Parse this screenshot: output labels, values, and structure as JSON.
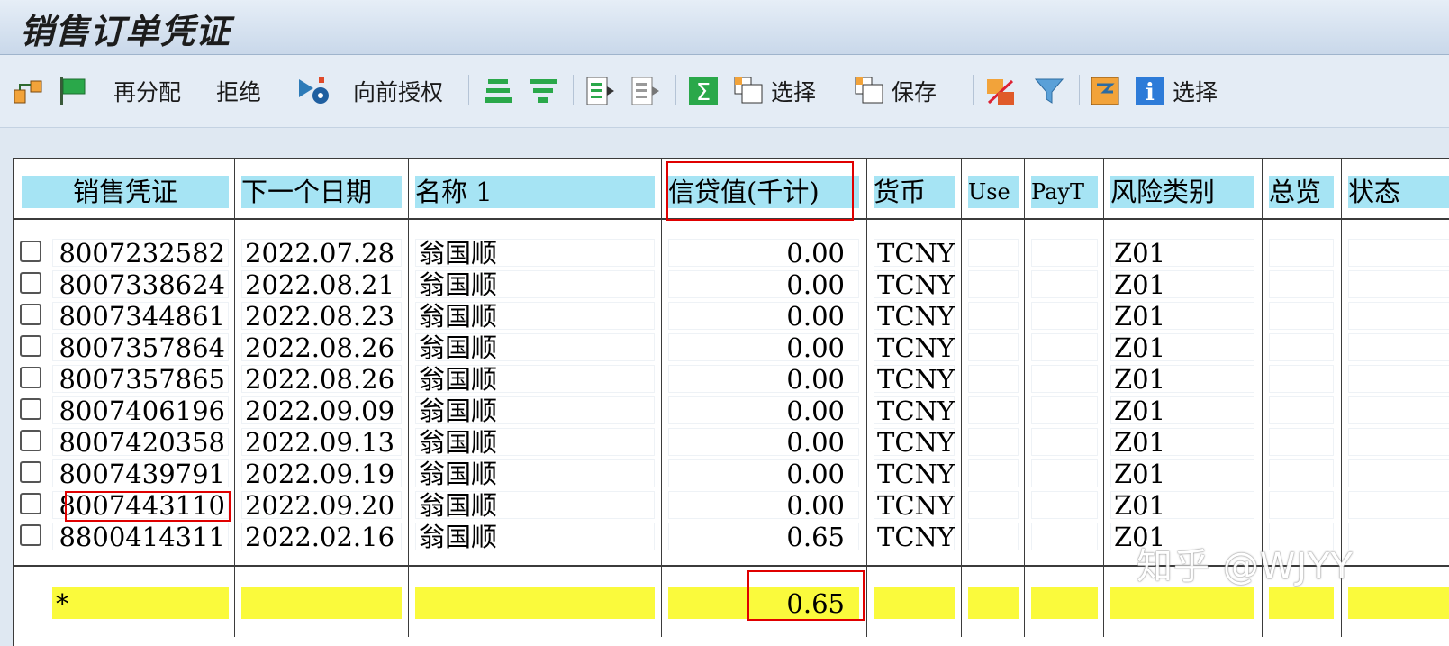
{
  "title": "销售订单凭证",
  "toolbar": {
    "reassign": "再分配",
    "reject": "拒绝",
    "forward_auth": "向前授权",
    "select1": "选择",
    "save": "保存",
    "select2": "选择"
  },
  "columns": [
    "销售凭证",
    "下一个日期",
    "名称 1",
    "信贷值(千计)",
    "货币",
    "Use",
    "PayT",
    "风险类别",
    "总览",
    "状态"
  ],
  "rows": [
    {
      "doc": "8007232582",
      "date": "2022.07.28",
      "name": "翁国顺",
      "credit": "0.00",
      "cur": "TCNY",
      "use": "",
      "payt": "",
      "risk": "Z01"
    },
    {
      "doc": "8007338624",
      "date": "2022.08.21",
      "name": "翁国顺",
      "credit": "0.00",
      "cur": "TCNY",
      "use": "",
      "payt": "",
      "risk": "Z01"
    },
    {
      "doc": "8007344861",
      "date": "2022.08.23",
      "name": "翁国顺",
      "credit": "0.00",
      "cur": "TCNY",
      "use": "",
      "payt": "",
      "risk": "Z01"
    },
    {
      "doc": "8007357864",
      "date": "2022.08.26",
      "name": "翁国顺",
      "credit": "0.00",
      "cur": "TCNY",
      "use": "",
      "payt": "",
      "risk": "Z01"
    },
    {
      "doc": "8007357865",
      "date": "2022.08.26",
      "name": "翁国顺",
      "credit": "0.00",
      "cur": "TCNY",
      "use": "",
      "payt": "",
      "risk": "Z01"
    },
    {
      "doc": "8007406196",
      "date": "2022.09.09",
      "name": "翁国顺",
      "credit": "0.00",
      "cur": "TCNY",
      "use": "",
      "payt": "",
      "risk": "Z01"
    },
    {
      "doc": "8007420358",
      "date": "2022.09.13",
      "name": "翁国顺",
      "credit": "0.00",
      "cur": "TCNY",
      "use": "",
      "payt": "",
      "risk": "Z01"
    },
    {
      "doc": "8007439791",
      "date": "2022.09.19",
      "name": "翁国顺",
      "credit": "0.00",
      "cur": "TCNY",
      "use": "",
      "payt": "",
      "risk": "Z01"
    },
    {
      "doc": "8007443110",
      "date": "2022.09.20",
      "name": "翁国顺",
      "credit": "0.00",
      "cur": "TCNY",
      "use": "",
      "payt": "",
      "risk": "Z01"
    },
    {
      "doc": "8800414311",
      "date": "2022.02.16",
      "name": "翁国顺",
      "credit": "0.65",
      "cur": "TCNY",
      "use": "",
      "payt": "",
      "risk": "Z01"
    }
  ],
  "totals": {
    "marker": "*",
    "credit": "0.65"
  },
  "watermark": "知乎 @WJYY",
  "colors": {
    "header_bg": "#a6e4f4",
    "total_bg": "#fafa3c",
    "highlight": "#e00000"
  }
}
